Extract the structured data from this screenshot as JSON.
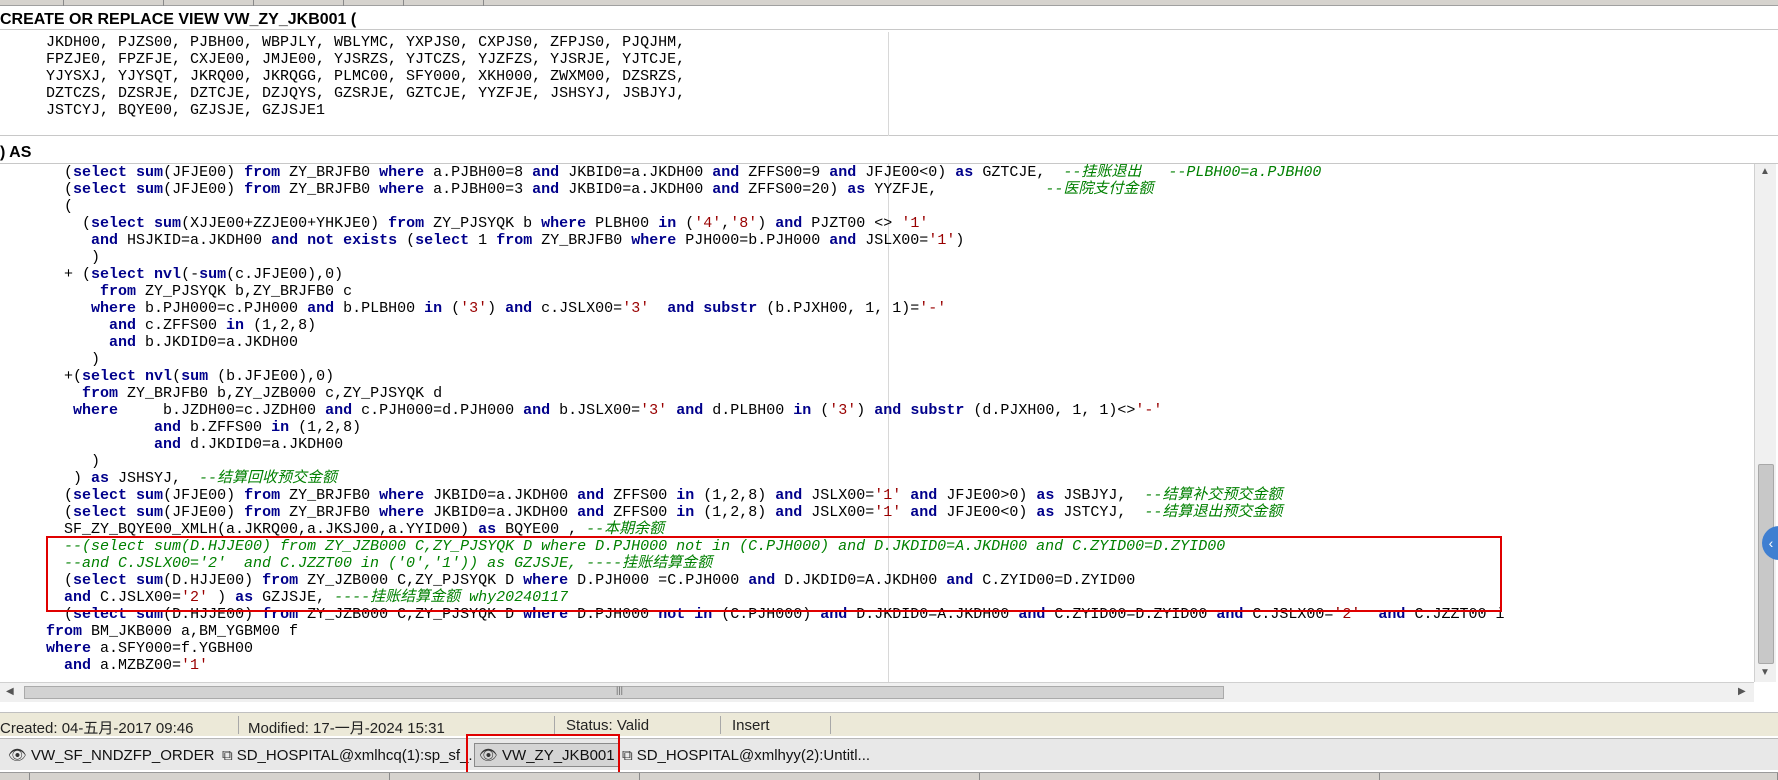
{
  "header": {
    "create_line": "CREATE OR REPLACE VIEW VW_ZY_JKB001 (",
    "as_line": ") AS"
  },
  "columns": [
    "JKDH00, PJZS00, PJBH00, WBPJLY, WBLYMC, YXPJS0, CXPJS0, ZFPJS0, PJQJHM,",
    "FPZJE0, FPZFJE, CXJE00, JMJE00, YJSRZS, YJTCZS, YJZFZS, YJSRJE, YJTCJE,",
    "YJYSXJ, YJYSQT, JKRQ00, JKRQGG, PLMC00, SFY000, XKH000, ZWXM00, DZSRZS,",
    "DZTCZS, DZSRJE, DZTCJE, DZJQYS, GZSRJE, GZTCJE, YYZFJE, JSHSYJ, JSBJYJ,",
    "JSTCYJ, BQYE00, GZJSJE, GZJSJE1"
  ],
  "editor": {
    "lines": [
      [
        {
          "t": "  ("
        },
        {
          "t": "select",
          "c": "kw"
        },
        {
          "t": " "
        },
        {
          "t": "sum",
          "c": "kw"
        },
        {
          "t": "(JFJE00) "
        },
        {
          "t": "from",
          "c": "kw"
        },
        {
          "t": " ZY_BRJFB0 "
        },
        {
          "t": "where",
          "c": "kw"
        },
        {
          "t": " a.PJBH00=8 "
        },
        {
          "t": "and",
          "c": "kw"
        },
        {
          "t": " JKBID0=a.JKDH00 "
        },
        {
          "t": "and",
          "c": "kw"
        },
        {
          "t": " ZFFS00=9 "
        },
        {
          "t": "and",
          "c": "kw"
        },
        {
          "t": " JFJE00<0) "
        },
        {
          "t": "as",
          "c": "kw"
        },
        {
          "t": " GZTCJE,  "
        },
        {
          "t": "--挂账退出   --PLBH00=a.PJBH00",
          "c": "cm"
        }
      ],
      [
        {
          "t": "  ("
        },
        {
          "t": "select",
          "c": "kw"
        },
        {
          "t": " "
        },
        {
          "t": "sum",
          "c": "kw"
        },
        {
          "t": "(JFJE00) "
        },
        {
          "t": "from",
          "c": "kw"
        },
        {
          "t": " ZY_BRJFB0 "
        },
        {
          "t": "where",
          "c": "kw"
        },
        {
          "t": " a.PJBH00=3 "
        },
        {
          "t": "and",
          "c": "kw"
        },
        {
          "t": " JKBID0=a.JKDH00 "
        },
        {
          "t": "and",
          "c": "kw"
        },
        {
          "t": " ZFFS00=20) "
        },
        {
          "t": "as",
          "c": "kw"
        },
        {
          "t": " YYZFJE,            "
        },
        {
          "t": "--医院支付金额",
          "c": "cm"
        }
      ],
      [
        {
          "t": "  ("
        }
      ],
      [
        {
          "t": "    ("
        },
        {
          "t": "select",
          "c": "kw"
        },
        {
          "t": " "
        },
        {
          "t": "sum",
          "c": "kw"
        },
        {
          "t": "(XJJE00+ZZJE00+YHKJE0) "
        },
        {
          "t": "from",
          "c": "kw"
        },
        {
          "t": " ZY_PJSYQK b "
        },
        {
          "t": "where",
          "c": "kw"
        },
        {
          "t": " PLBH00 "
        },
        {
          "t": "in",
          "c": "kw"
        },
        {
          "t": " ("
        },
        {
          "t": "'4'",
          "c": "str"
        },
        {
          "t": ","
        },
        {
          "t": "'8'",
          "c": "str"
        },
        {
          "t": ") "
        },
        {
          "t": "and",
          "c": "kw"
        },
        {
          "t": " PJZT00 <> "
        },
        {
          "t": "'1'",
          "c": "str"
        }
      ],
      [
        {
          "t": "     "
        },
        {
          "t": "and",
          "c": "kw"
        },
        {
          "t": " HSJKID=a.JKDH00 "
        },
        {
          "t": "and",
          "c": "kw"
        },
        {
          "t": " "
        },
        {
          "t": "not",
          "c": "kw"
        },
        {
          "t": " "
        },
        {
          "t": "exists",
          "c": "kw"
        },
        {
          "t": " ("
        },
        {
          "t": "select",
          "c": "kw"
        },
        {
          "t": " 1 "
        },
        {
          "t": "from",
          "c": "kw"
        },
        {
          "t": " ZY_BRJFB0 "
        },
        {
          "t": "where",
          "c": "kw"
        },
        {
          "t": " PJH000=b.PJH000 "
        },
        {
          "t": "and",
          "c": "kw"
        },
        {
          "t": " JSLX00="
        },
        {
          "t": "'1'",
          "c": "str"
        },
        {
          "t": ")"
        }
      ],
      [
        {
          "t": "     )"
        }
      ],
      [
        {
          "t": "  + ("
        },
        {
          "t": "select",
          "c": "kw"
        },
        {
          "t": " "
        },
        {
          "t": "nvl",
          "c": "kw"
        },
        {
          "t": "(-"
        },
        {
          "t": "sum",
          "c": "kw"
        },
        {
          "t": "(c.JFJE00),0)"
        }
      ],
      [
        {
          "t": "      "
        },
        {
          "t": "from",
          "c": "kw"
        },
        {
          "t": " ZY_PJSYQK b,ZY_BRJFB0 c"
        }
      ],
      [
        {
          "t": "     "
        },
        {
          "t": "where",
          "c": "kw"
        },
        {
          "t": " b.PJH000=c.PJH000 "
        },
        {
          "t": "and",
          "c": "kw"
        },
        {
          "t": " b.PLBH00 "
        },
        {
          "t": "in",
          "c": "kw"
        },
        {
          "t": " ("
        },
        {
          "t": "'3'",
          "c": "str"
        },
        {
          "t": ") "
        },
        {
          "t": "and",
          "c": "kw"
        },
        {
          "t": " c.JSLX00="
        },
        {
          "t": "'3'",
          "c": "str"
        },
        {
          "t": "  "
        },
        {
          "t": "and",
          "c": "kw"
        },
        {
          "t": " "
        },
        {
          "t": "substr",
          "c": "kw"
        },
        {
          "t": " (b.PJXH00, 1, 1)="
        },
        {
          "t": "'-'",
          "c": "str"
        }
      ],
      [
        {
          "t": "       "
        },
        {
          "t": "and",
          "c": "kw"
        },
        {
          "t": " c.ZFFS00 "
        },
        {
          "t": "in",
          "c": "kw"
        },
        {
          "t": " (1,2,8)"
        }
      ],
      [
        {
          "t": "       "
        },
        {
          "t": "and",
          "c": "kw"
        },
        {
          "t": " b.JKDID0=a.JKDH00"
        }
      ],
      [
        {
          "t": "     )"
        }
      ],
      [
        {
          "t": "  +("
        },
        {
          "t": "select",
          "c": "kw"
        },
        {
          "t": " "
        },
        {
          "t": "nvl",
          "c": "kw"
        },
        {
          "t": "("
        },
        {
          "t": "sum",
          "c": "kw"
        },
        {
          "t": " (b.JFJE00),0)"
        }
      ],
      [
        {
          "t": "    "
        },
        {
          "t": "from",
          "c": "kw"
        },
        {
          "t": " ZY_BRJFB0 b,ZY_JZB000 c,ZY_PJSYQK d"
        }
      ],
      [
        {
          "t": "   "
        },
        {
          "t": "where",
          "c": "kw"
        },
        {
          "t": "     b.JZDH00=c.JZDH00 "
        },
        {
          "t": "and",
          "c": "kw"
        },
        {
          "t": " c.PJH000=d.PJH000 "
        },
        {
          "t": "and",
          "c": "kw"
        },
        {
          "t": " b.JSLX00="
        },
        {
          "t": "'3'",
          "c": "str"
        },
        {
          "t": " "
        },
        {
          "t": "and",
          "c": "kw"
        },
        {
          "t": " d.PLBH00 "
        },
        {
          "t": "in",
          "c": "kw"
        },
        {
          "t": " ("
        },
        {
          "t": "'3'",
          "c": "str"
        },
        {
          "t": ") "
        },
        {
          "t": "and",
          "c": "kw"
        },
        {
          "t": " "
        },
        {
          "t": "substr",
          "c": "kw"
        },
        {
          "t": " (d.PJXH00, 1, 1)<>"
        },
        {
          "t": "'-'",
          "c": "str"
        }
      ],
      [
        {
          "t": "            "
        },
        {
          "t": "and",
          "c": "kw"
        },
        {
          "t": " b.ZFFS00 "
        },
        {
          "t": "in",
          "c": "kw"
        },
        {
          "t": " (1,2,8)"
        }
      ],
      [
        {
          "t": "            "
        },
        {
          "t": "and",
          "c": "kw"
        },
        {
          "t": " d.JKDID0=a.JKDH00"
        }
      ],
      [
        {
          "t": "     )"
        }
      ],
      [
        {
          "t": "   ) "
        },
        {
          "t": "as",
          "c": "kw"
        },
        {
          "t": " JSHSYJ,  "
        },
        {
          "t": "--结算回收预交金额",
          "c": "cm"
        }
      ],
      [
        {
          "t": "  ("
        },
        {
          "t": "select",
          "c": "kw"
        },
        {
          "t": " "
        },
        {
          "t": "sum",
          "c": "kw"
        },
        {
          "t": "(JFJE00) "
        },
        {
          "t": "from",
          "c": "kw"
        },
        {
          "t": " ZY_BRJFB0 "
        },
        {
          "t": "where",
          "c": "kw"
        },
        {
          "t": " JKBID0=a.JKDH00 "
        },
        {
          "t": "and",
          "c": "kw"
        },
        {
          "t": " ZFFS00 "
        },
        {
          "t": "in",
          "c": "kw"
        },
        {
          "t": " (1,2,8) "
        },
        {
          "t": "and",
          "c": "kw"
        },
        {
          "t": " JSLX00="
        },
        {
          "t": "'1'",
          "c": "str"
        },
        {
          "t": " "
        },
        {
          "t": "and",
          "c": "kw"
        },
        {
          "t": " JFJE00>0) "
        },
        {
          "t": "as",
          "c": "kw"
        },
        {
          "t": " JSBJYJ,  "
        },
        {
          "t": "--结算补交预交金额",
          "c": "cm"
        }
      ],
      [
        {
          "t": "  ("
        },
        {
          "t": "select",
          "c": "kw"
        },
        {
          "t": " "
        },
        {
          "t": "sum",
          "c": "kw"
        },
        {
          "t": "(JFJE00) "
        },
        {
          "t": "from",
          "c": "kw"
        },
        {
          "t": " ZY_BRJFB0 "
        },
        {
          "t": "where",
          "c": "kw"
        },
        {
          "t": " JKBID0=a.JKDH00 "
        },
        {
          "t": "and",
          "c": "kw"
        },
        {
          "t": " ZFFS00 "
        },
        {
          "t": "in",
          "c": "kw"
        },
        {
          "t": " (1,2,8) "
        },
        {
          "t": "and",
          "c": "kw"
        },
        {
          "t": " JSLX00="
        },
        {
          "t": "'1'",
          "c": "str"
        },
        {
          "t": " "
        },
        {
          "t": "and",
          "c": "kw"
        },
        {
          "t": " JFJE00<0) "
        },
        {
          "t": "as",
          "c": "kw"
        },
        {
          "t": " JSTCYJ,  "
        },
        {
          "t": "--结算退出预交金额",
          "c": "cm"
        }
      ],
      [
        {
          "t": "  SF_ZY_BQYE00_XMLH(a.JKRQ00,a.JKSJ00,a.YYID00) "
        },
        {
          "t": "as",
          "c": "kw"
        },
        {
          "t": " BQYE00 , "
        },
        {
          "t": "--本期余额",
          "c": "cm"
        }
      ],
      [
        {
          "t": "  --(select sum(D.HJJE00) from ZY_JZB000 C,ZY_PJSYQK D where D.PJH000 not in (C.PJH000) and D.JKDID0=A.JKDH00 and C.ZYID00=D.ZYID00",
          "c": "cm"
        }
      ],
      [
        {
          "t": "  --and C.JSLX00='2'  and C.JZZT00 in ('0','1')) as GZJSJE, ----挂账结算金额",
          "c": "cm"
        }
      ],
      [
        {
          "t": "  ("
        },
        {
          "t": "select",
          "c": "kw"
        },
        {
          "t": " "
        },
        {
          "t": "sum",
          "c": "kw"
        },
        {
          "t": "(D.HJJE00) "
        },
        {
          "t": "from",
          "c": "kw"
        },
        {
          "t": " ZY_JZB000 C,ZY_PJSYQK D "
        },
        {
          "t": "where",
          "c": "kw"
        },
        {
          "t": " D.PJH000 =C.PJH000 "
        },
        {
          "t": "and",
          "c": "kw"
        },
        {
          "t": " D.JKDID0=A.JKDH00 "
        },
        {
          "t": "and",
          "c": "kw"
        },
        {
          "t": " C.ZYID00=D.ZYID00"
        }
      ],
      [
        {
          "t": "  "
        },
        {
          "t": "and",
          "c": "kw"
        },
        {
          "t": " C.JSLX00="
        },
        {
          "t": "'2'",
          "c": "str"
        },
        {
          "t": " ) "
        },
        {
          "t": "as",
          "c": "kw"
        },
        {
          "t": " GZJSJE, "
        },
        {
          "t": "----挂账结算金额 why20240117",
          "c": "cm"
        }
      ],
      [
        {
          "t": "  ("
        },
        {
          "t": "select",
          "c": "kw"
        },
        {
          "t": " "
        },
        {
          "t": "sum",
          "c": "kw"
        },
        {
          "t": "(D.HJJE00) "
        },
        {
          "t": "from",
          "c": "kw"
        },
        {
          "t": " ZY_JZB000 C,ZY_PJSYQK D "
        },
        {
          "t": "where",
          "c": "kw"
        },
        {
          "t": " D.PJH000 "
        },
        {
          "t": "not",
          "c": "kw"
        },
        {
          "t": " "
        },
        {
          "t": "in",
          "c": "kw"
        },
        {
          "t": " (C.PJH000) "
        },
        {
          "t": "and",
          "c": "kw"
        },
        {
          "t": " D.JKDID0=A.JKDH00 "
        },
        {
          "t": "and",
          "c": "kw"
        },
        {
          "t": " C.ZYID00=D.ZYID00 "
        },
        {
          "t": "and",
          "c": "kw"
        },
        {
          "t": " C.JSLX00="
        },
        {
          "t": "'2'",
          "c": "str"
        },
        {
          "t": "  "
        },
        {
          "t": "and",
          "c": "kw"
        },
        {
          "t": " C.JZZT00 i"
        }
      ],
      [
        {
          "t": "from",
          "c": "kw"
        },
        {
          "t": " BM_JKB000 a,BM_YGBM00 f"
        }
      ],
      [
        {
          "t": "where",
          "c": "kw"
        },
        {
          "t": " a.SFY000=f.YGBH00"
        }
      ],
      [
        {
          "t": "  "
        },
        {
          "t": "and",
          "c": "kw"
        },
        {
          "t": " a.MZBZ00="
        },
        {
          "t": "'1'",
          "c": "str"
        }
      ]
    ]
  },
  "statusbar": {
    "created": "Created: 04-五月-2017 09:46",
    "modified": "Modified: 17-一月-2024 15:31",
    "status": "Status: Valid",
    "mode": "Insert"
  },
  "taskbar": {
    "items": [
      {
        "label": "VW_SF_NNDZFP_ORDER",
        "icon": "eye-icon"
      },
      {
        "label": "SD_HOSPITAL@xmlhcq(1):sp_sf_...",
        "icon": "procedure-icon"
      },
      {
        "label": "VW_ZY_JKB001",
        "icon": "eye-icon"
      },
      {
        "label": "SD_HOSPITAL@xmlhyy(2):Untitl...",
        "icon": "sql-window-icon"
      }
    ]
  },
  "colors": {
    "keyword": "#00008b",
    "string": "#990000",
    "comment": "#008000",
    "highlight_box": "#e00000"
  }
}
